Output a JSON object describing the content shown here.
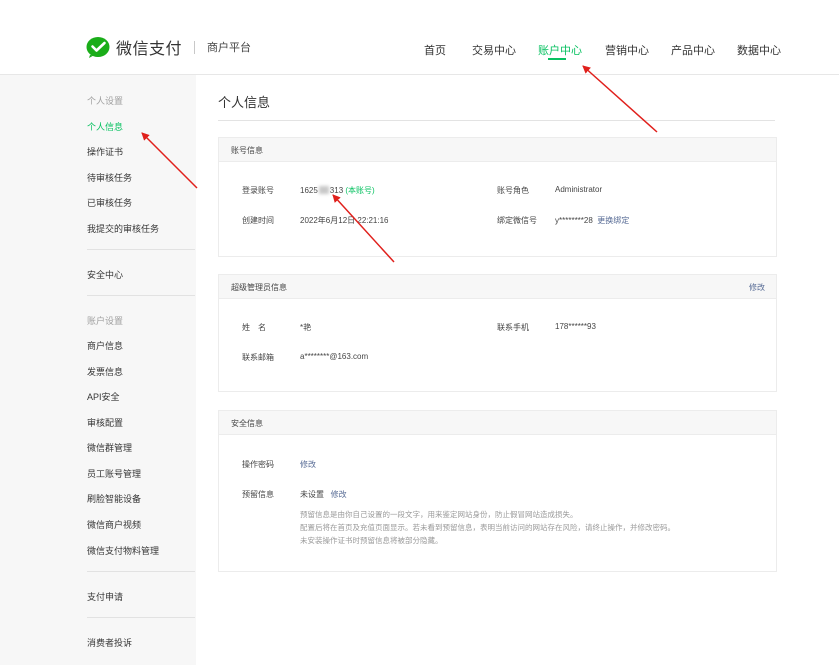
{
  "header": {
    "brand": "微信支付",
    "platform": "商户平台",
    "nav": [
      {
        "label": "首页",
        "active": false
      },
      {
        "label": "交易中心",
        "active": false
      },
      {
        "label": "账户中心",
        "active": true
      },
      {
        "label": "营销中心",
        "active": false
      },
      {
        "label": "产品中心",
        "active": false
      },
      {
        "label": "数据中心",
        "active": false
      }
    ]
  },
  "sidebar": {
    "group1_title": "个人设置",
    "group1": [
      "个人信息",
      "操作证书",
      "待审核任务",
      "已审核任务",
      "我提交的审核任务"
    ],
    "security_center": "安全中心",
    "group2_title": "账户设置",
    "group2": [
      "商户信息",
      "发票信息",
      "API安全",
      "审核配置",
      "微信群管理",
      "员工账号管理",
      "刷脸智能设备",
      "微信商户视频",
      "微信支付物料管理"
    ],
    "pay_apply": "支付申请",
    "complaints": "消费者投诉"
  },
  "main": {
    "title": "个人信息",
    "account": {
      "section_title": "账号信息",
      "login_label": "登录账号",
      "login_prefix": "1625",
      "login_suffix": "313",
      "login_tag": "(本账号)",
      "role_label": "账号角色",
      "role_value": "Administrator",
      "created_label": "创建时间",
      "created_value": "2022年6月12日 22:21:16",
      "wechat_label": "绑定微信号",
      "wechat_value": "y********28",
      "wechat_action": "更换绑定"
    },
    "admin": {
      "section_title": "超级管理员信息",
      "edit": "修改",
      "name_label": "姓　名",
      "name_value": "*艳",
      "phone_label": "联系手机",
      "phone_value": "178******93",
      "email_label": "联系邮箱",
      "email_value": "a********@163.com"
    },
    "security": {
      "section_title": "安全信息",
      "pwd_label": "操作密码",
      "pwd_action": "修改",
      "reserve_label": "预留信息",
      "reserve_value": "未设置",
      "reserve_action": "修改",
      "notes": [
        "预留信息是由你自己设置的一段文字，用来鉴定网站身份，防止假冒网站造成损失。",
        "配置后将在首页及充值页面显示。若未看到预留信息，表明当前访问的网站存在风险，请终止操作，并修改密码。",
        "未安装操作证书时预留信息将被部分隐藏。"
      ]
    }
  },
  "colors": {
    "accent": "#07c160",
    "link": "#576b95",
    "arrow": "#e0201c"
  }
}
